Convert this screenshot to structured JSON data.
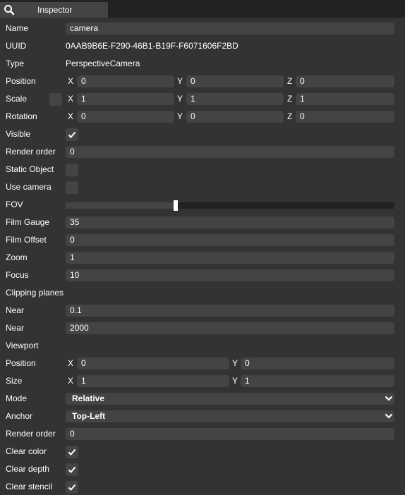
{
  "tab": {
    "title": "Inspector",
    "icon": "search-icon"
  },
  "name": {
    "label": "Name",
    "value": "camera"
  },
  "uuid": {
    "label": "UUID",
    "value": "0AAB9B6E-F290-46B1-B19F-F6071606F2BD"
  },
  "type": {
    "label": "Type",
    "value": "PerspectiveCamera"
  },
  "position": {
    "label": "Position",
    "x": "0",
    "y": "0",
    "z": "0"
  },
  "scale": {
    "label": "Scale",
    "x": "1",
    "y": "1",
    "z": "1"
  },
  "rotation": {
    "label": "Rotation",
    "x": "0",
    "y": "0",
    "z": "0"
  },
  "axes": {
    "x": "X",
    "y": "Y",
    "z": "Z"
  },
  "visible": {
    "label": "Visible",
    "checked": true
  },
  "render_order": {
    "label": "Render order",
    "value": "0"
  },
  "static_object": {
    "label": "Static Object",
    "checked": false
  },
  "use_camera": {
    "label": "Use camera",
    "checked": false
  },
  "fov": {
    "label": "FOV",
    "fraction": 0.335
  },
  "film_gauge": {
    "label": "Film Gauge",
    "value": "35"
  },
  "film_offset": {
    "label": "Film Offset",
    "value": "0"
  },
  "zoom": {
    "label": "Zoom",
    "value": "1"
  },
  "focus": {
    "label": "Focus",
    "value": "10"
  },
  "clipping": {
    "label": "Clipping planes"
  },
  "near": {
    "label": "Near",
    "value": "0.1"
  },
  "far": {
    "label": "Near",
    "value": "2000"
  },
  "viewport": {
    "label": "Viewport"
  },
  "vp_position": {
    "label": "Position",
    "x": "0",
    "y": "0"
  },
  "vp_size": {
    "label": "Size",
    "x": "1",
    "y": "1"
  },
  "mode": {
    "label": "Mode",
    "value": "Relative"
  },
  "anchor": {
    "label": "Anchor",
    "value": "Top-Left"
  },
  "render_order2": {
    "label": "Render order",
    "value": "0"
  },
  "clear_color": {
    "label": "Clear color",
    "checked": true
  },
  "clear_depth": {
    "label": "Clear depth",
    "checked": true
  },
  "clear_stencil": {
    "label": "Clear stencil",
    "checked": true
  },
  "colors": {
    "panel": "#333333",
    "field": "#444444",
    "background": "#222222"
  }
}
